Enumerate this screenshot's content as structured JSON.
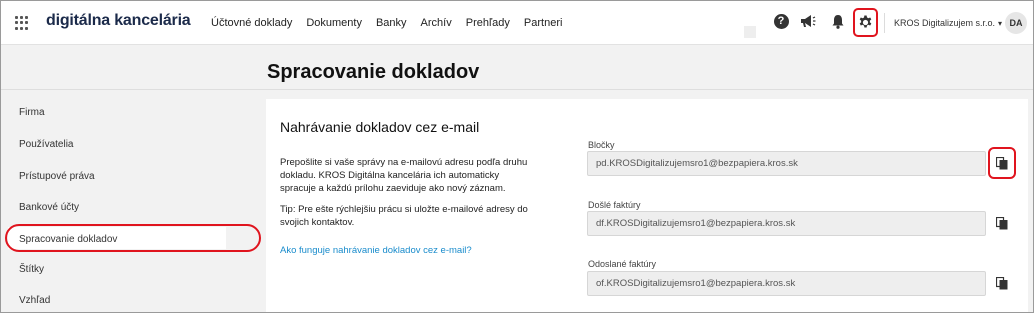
{
  "header": {
    "brand": "digitálna kancelária",
    "nav": [
      "Účtovné doklady",
      "Dokumenty",
      "Banky",
      "Archív",
      "Prehľady",
      "Partneri"
    ],
    "help_symbol": "?",
    "company": "KROS Digitalizujem s.r.o.",
    "company_chevron": "▾",
    "avatar": "DA",
    "icons": [
      "apps-grid-icon",
      "help-icon",
      "megaphone-icon",
      "bell-icon",
      "gear-icon",
      "chevron-down-icon"
    ]
  },
  "page": {
    "title": "Spracovanie dokladov"
  },
  "sidebar": {
    "items": [
      {
        "label": "Firma"
      },
      {
        "label": "Používatelia"
      },
      {
        "label": "Prístupové práva"
      },
      {
        "label": "Bankové účty"
      },
      {
        "label": "Spracovanie dokladov",
        "active": true
      },
      {
        "label": "Štítky"
      },
      {
        "label": "Vzhľad"
      }
    ]
  },
  "card": {
    "title": "Nahrávanie dokladov cez e-mail",
    "description": "Prepošlite si vaše správy na e-mailovú adresu podľa druhu dokladu. KROS Digitálna kancelária ich automaticky spracuje a každú prílohu zaeviduje ako nový záznam.",
    "tip": "Tip: Pre ešte rýchlejšiu prácu si uložte e-mailové adresy do svojich kontaktov.",
    "link": "Ako funguje nahrávanie dokladov cez e-mail?",
    "fields": [
      {
        "label": "Bločky",
        "value": "pd.KROSDigitalizujemsro1@bezpapiera.kros.sk"
      },
      {
        "label": "Došlé faktúry",
        "value": "df.KROSDigitalizujemsro1@bezpapiera.kros.sk"
      },
      {
        "label": "Odoslané faktúry",
        "value": "of.KROSDigitalizujemsro1@bezpapiera.kros.sk"
      }
    ]
  },
  "colors": {
    "highlight": "#e0141e",
    "link": "#1a8ccc",
    "brand": "#1b2a4a"
  }
}
